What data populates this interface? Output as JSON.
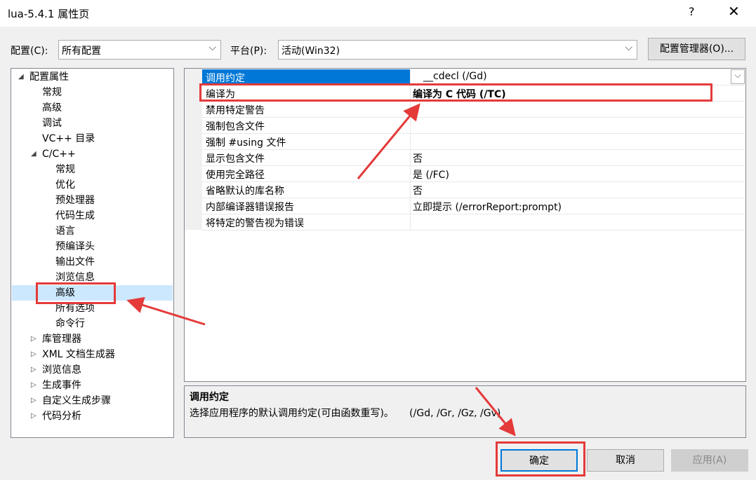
{
  "window": {
    "title": "lua-5.4.1 属性页",
    "help": "?",
    "close": "✕"
  },
  "config": {
    "label": "配置(C):",
    "value": "所有配置"
  },
  "platform": {
    "label": "平台(P):",
    "value": "活动(Win32)"
  },
  "config_manager_label": "配置管理器(O)...",
  "tree": {
    "root": "配置属性",
    "general": [
      "常规",
      "高级",
      "调试",
      "VC++ 目录"
    ],
    "cpp": "C/C++",
    "cpp_items": [
      "常规",
      "优化",
      "预处理器",
      "代码生成",
      "语言",
      "预编译头",
      "输出文件",
      "浏览信息",
      "高级",
      "所有选项",
      "命令行"
    ],
    "collapsed": [
      "库管理器",
      "XML 文档生成器",
      "浏览信息",
      "生成事件",
      "自定义生成步骤",
      "代码分析"
    ]
  },
  "grid": [
    {
      "name": "调用约定",
      "value": "__cdecl (/Gd)"
    },
    {
      "name": "编译为",
      "value": "编译为 C 代码 (/TC)"
    },
    {
      "name": "禁用特定警告",
      "value": ""
    },
    {
      "name": "强制包含文件",
      "value": ""
    },
    {
      "name": "强制 #using 文件",
      "value": ""
    },
    {
      "name": "显示包含文件",
      "value": "否"
    },
    {
      "name": "使用完全路径",
      "value": "是 (/FC)"
    },
    {
      "name": "省略默认的库名称",
      "value": "否"
    },
    {
      "name": "内部编译器错误报告",
      "value": "立即提示 (/errorReport:prompt)"
    },
    {
      "name": "将特定的警告视为错误",
      "value": ""
    }
  ],
  "desc": {
    "title": "调用约定",
    "text": "选择应用程序的默认调用约定(可由函数重写)。     (/Gd, /Gr, /Gz, /Gv)"
  },
  "buttons": {
    "ok": "确定",
    "cancel": "取消",
    "apply": "应用(A)"
  },
  "colors": {
    "selection": "#0078d7",
    "tree_selection": "#cce8ff",
    "annotation": "#e43a3a"
  }
}
